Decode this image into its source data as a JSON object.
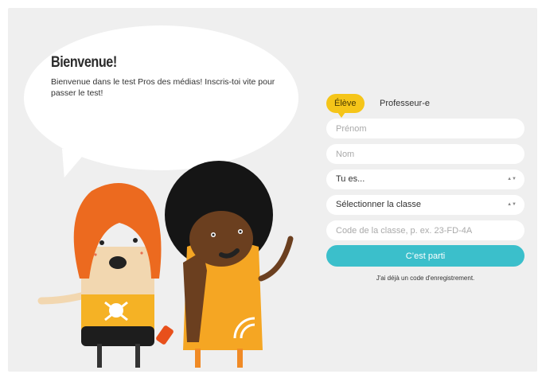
{
  "welcome": {
    "title": "Bienvenue!",
    "text": "Bienvenue dans le test Pros des médias! Inscris-toi vite pour passer le test!"
  },
  "form": {
    "tabs": [
      {
        "label": "Élève",
        "active": true
      },
      {
        "label": "Professeur-e",
        "active": false
      }
    ],
    "fields": {
      "first_name_placeholder": "Prénom",
      "last_name_placeholder": "Nom",
      "class_code_placeholder": "Code de la classe, p. ex. 23-FD-4A"
    },
    "selects": {
      "role": "Tu es...",
      "class": "Sélectionner la classe"
    },
    "submit_label": "C’est parti",
    "code_link": "J'ai déjà un code d'enregistrement."
  },
  "colors": {
    "accent": "#3bbfcb",
    "tab_active": "#f5c519",
    "panel_bg": "#efefef"
  }
}
